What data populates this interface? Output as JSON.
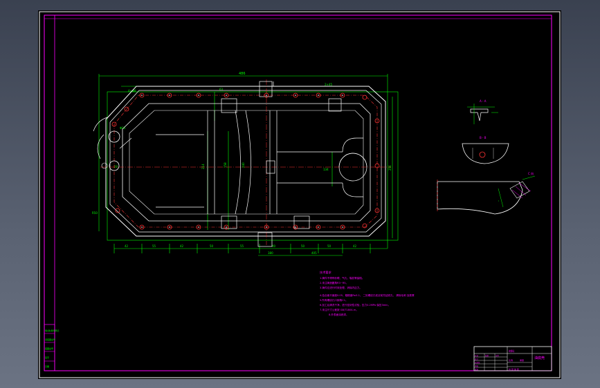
{
  "title_block": {
    "drawing_name": "油底壳",
    "company_cell": "材料",
    "row_cells": [
      "标记",
      "处数",
      "分区",
      "更改文件号",
      "签名",
      "年月日"
    ],
    "design_cells": [
      "设计",
      "标准化",
      "审核",
      "工艺",
      "批准"
    ],
    "scale_label": "比例",
    "weight_label": "重量",
    "sheet_label": "共 张 第 张"
  },
  "side_stamp": {
    "lines": [
      "借(通)用件登记",
      "旧底图总号",
      "底图总号",
      "签字",
      "日期"
    ]
  },
  "notes": {
    "heading": "技术要求",
    "lines": [
      "1.铸件不得有砂眼、气孔、裂纹等缺陷。",
      "2.未注铸造圆角R3~R5。",
      "3.铸件应进行时效处理，消除内应力。",
      "4.结合面平面度0.05，粗糙度Ra3.2。 二处螺纹孔攻丝前先钻底孔， 清除毛刺 及铁屑",
      "5.所有螺纹孔口倒角C1。",
      "6.加工后清洗干净，进行密封性试验，压力0.2MPa 保压3min。",
      "7.未注尺寸公差按 GB/T1804-m。",
      "8.外表面涂底漆。"
    ]
  },
  "dimensions": {
    "overall_top": "486",
    "top_left": "4×Φ8",
    "top_mid": "63",
    "top_right": "2×45",
    "bottom_row": [
      "42",
      "55",
      "42",
      "50",
      "55",
      "40",
      "50",
      "50",
      "42"
    ],
    "bottom_mid": [
      "380",
      "405"
    ],
    "left_side": "R50",
    "height_a": "214",
    "height_b": "158",
    "height_c": "240",
    "right_side": "256",
    "center_a": "134",
    "center_b": "20",
    "hole": "Φ25"
  },
  "section_labels": {
    "a_a": "A - A",
    "b_b": "B - B",
    "view_c": "C 向",
    "detail": "I"
  }
}
